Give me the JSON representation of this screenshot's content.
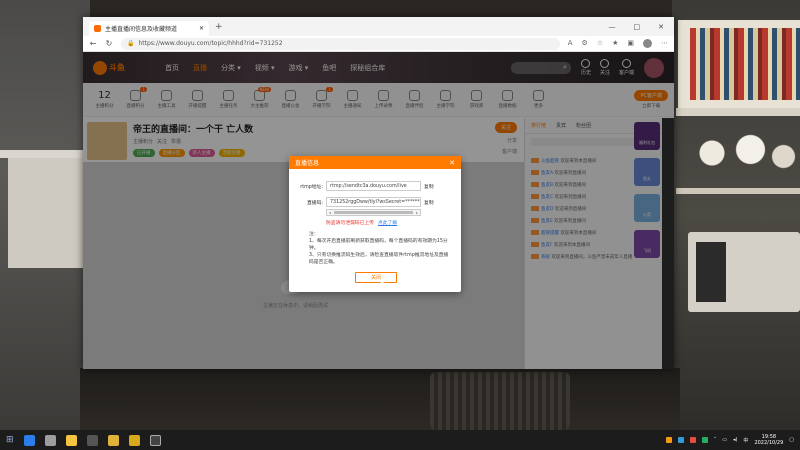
{
  "browser": {
    "tab_title": "主播直播间信息及收藏频道",
    "new_tab": "+",
    "url": "https://www.douyu.com/topic/hhhd?rid=731252",
    "window_controls": [
      "—",
      "□",
      "✕"
    ]
  },
  "site": {
    "logo": "斗鱼",
    "nav": [
      "首页",
      "直播",
      "分类 ▾",
      "视频 ▾",
      "游戏 ▾",
      "鱼吧",
      "探秘组合库"
    ],
    "header_icons": [
      "历史",
      "关注",
      "客户端"
    ]
  },
  "catbar": {
    "count": "12",
    "count_label": "主播积分",
    "items": [
      {
        "label": "直播积分",
        "badge": "1"
      },
      {
        "label": "主播工具",
        "badge": ""
      },
      {
        "label": "开播提醒",
        "badge": ""
      },
      {
        "label": "主播任务",
        "badge": ""
      },
      {
        "label": "大主推荐",
        "badge": "NEW"
      },
      {
        "label": "直播公会",
        "badge": ""
      },
      {
        "label": "开播学院",
        "badge": "1"
      },
      {
        "label": "主播通知",
        "badge": ""
      },
      {
        "label": "上传录像",
        "badge": ""
      },
      {
        "label": "直播伴侣",
        "badge": ""
      },
      {
        "label": "主播学院",
        "badge": ""
      },
      {
        "label": "游戏库",
        "badge": ""
      },
      {
        "label": "直播数据",
        "badge": ""
      },
      {
        "label": "更多",
        "badge": ""
      }
    ],
    "pc_button": "PC客户端",
    "pc_sub": "立即下载"
  },
  "room": {
    "title": "帝王的直播间：一个干 亡人数",
    "meta": [
      "主播积分",
      "关注",
      "举报"
    ],
    "tags": [
      "已开播",
      "直播分区",
      "新人主播",
      "活跃主播"
    ],
    "follow": "关注",
    "right_meta": [
      "分享",
      "客户端"
    ],
    "hint": "主播正在休息中，请稍后再试"
  },
  "sidebar": {
    "tabs": [
      "排行榜",
      "贵宾",
      "粉丝团"
    ],
    "chat": [
      {
        "name": "斗鱼超管",
        "text": "欢迎来到本直播间"
      },
      {
        "name": "鱼友A",
        "text": "欢迎来到直播间"
      },
      {
        "name": "鱼友B",
        "text": "欢迎来到直播间"
      },
      {
        "name": "鱼友C",
        "text": "欢迎来到直播间"
      },
      {
        "name": "鱼友D",
        "text": "欢迎来到直播间"
      },
      {
        "name": "鱼友E",
        "text": "欢迎来到直播间"
      },
      {
        "name": "超管提醒",
        "text": "欢迎来到本直播间"
      },
      {
        "name": "鱼友F",
        "text": "欢迎来到本直播间"
      },
      {
        "name": "系统",
        "text": "欢迎来到直播间，斗鱼严禁未成年人直播"
      }
    ],
    "gifts": [
      "福利礼包",
      "鱼丸",
      "火箭",
      "飞机"
    ]
  },
  "modal": {
    "title": "直播信息",
    "close_x": "✕",
    "rtmp_label": "rtmp地址:",
    "rtmp_value": "rtmp://sendtc3a.douyu.com/live",
    "stream_label": "直播码:",
    "stream_value": "731252rggDww/tlyl?wsSecret=**********",
    "copy": "复制",
    "warn_text": "防盗请勿泄漏码已上传",
    "warn_link": "点此了解",
    "notes_title": "注：",
    "notes": [
      "1、每次开启直播前刷新获取直播码，每个直播码的有效期为15分钟。",
      "2、只有切换推流码生效",
      "3、只有切换推流码生效后，请检查直播软件rtmp推流地址及直播码是否正确。"
    ],
    "close_button": "关闭"
  },
  "taskbar": {
    "time": "19:58",
    "date": "2022/10/29"
  },
  "colors": {
    "accent": "#ff7b00",
    "link": "#2d7be5",
    "warning": "#e6322f"
  }
}
